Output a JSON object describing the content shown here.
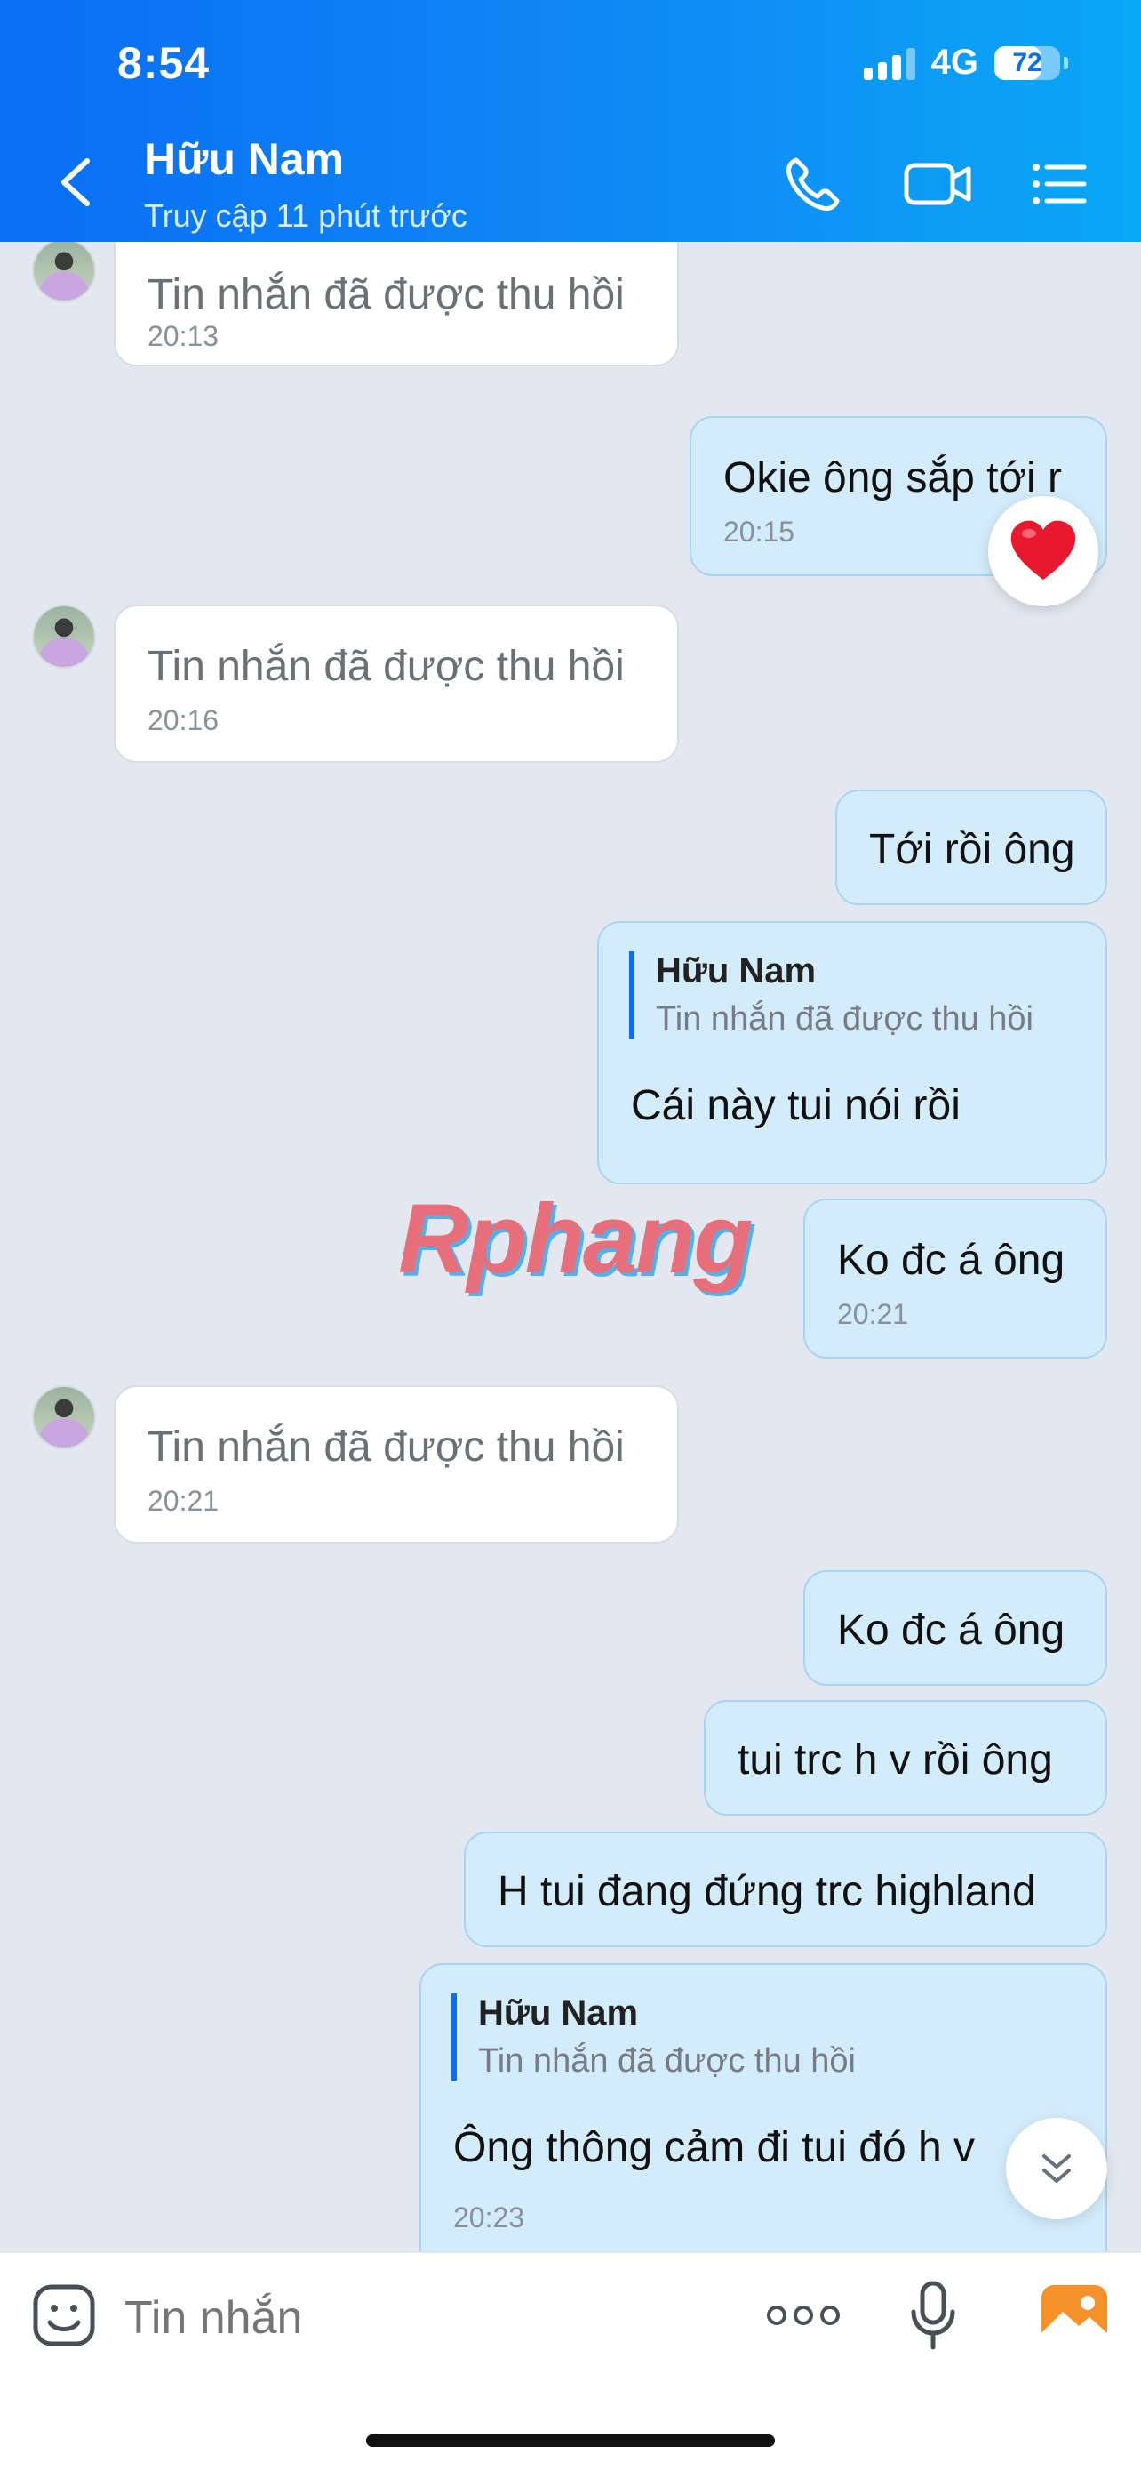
{
  "status_bar": {
    "time": "8:54",
    "network": "4G",
    "battery": "72"
  },
  "header": {
    "contact_name": "Hữu Nam",
    "contact_status": "Truy cập 11 phút trước",
    "icons": [
      "chevron-left-icon",
      "phone-icon",
      "video-camera-icon",
      "menu-list-icon"
    ]
  },
  "messages": [
    {
      "side": "in",
      "text": "Tin nhắn đã được thu hồi",
      "time": "20:13"
    },
    {
      "side": "out",
      "text": "Okie ông sắp tới r",
      "time": "20:15",
      "reaction": "heart"
    },
    {
      "side": "in",
      "text": "Tin nhắn đã được thu hồi",
      "time": "20:16"
    },
    {
      "side": "out",
      "text": "Tới rồi ông"
    },
    {
      "side": "out",
      "quote_name": "Hữu Nam",
      "quote_text": "Tin nhắn đã được thu hồi",
      "text": "Cái này tui nói rồi"
    },
    {
      "side": "out",
      "text": "Ko đc á ông",
      "time": "20:21"
    },
    {
      "side": "in",
      "text": "Tin nhắn đã được thu hồi",
      "time": "20:21"
    },
    {
      "side": "out",
      "text": "Ko đc á ông"
    },
    {
      "side": "out",
      "text": "tui trc h v rồi ông"
    },
    {
      "side": "out",
      "text": "H tui đang đứng trc highland"
    },
    {
      "side": "out",
      "quote_name": "Hữu Nam",
      "quote_text": "Tin nhắn đã được thu hồi",
      "text": "Ông thông cảm đi tui đó h v",
      "time": "20:23"
    }
  ],
  "watermark": "Rphang",
  "composer": {
    "placeholder": "Tin nhắn"
  },
  "colors": {
    "header_start": "#0a6ef5",
    "header_end": "#0aa8f5",
    "outgoing_bubble": "#d3ecfb",
    "incoming_bubble": "#ffffff",
    "chat_background": "#e3e8f0"
  }
}
